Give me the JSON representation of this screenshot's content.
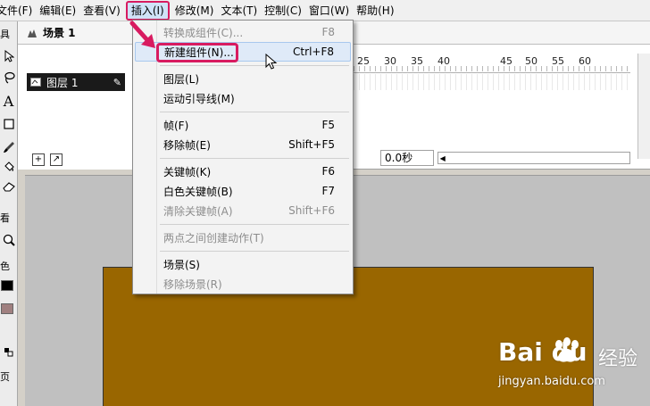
{
  "colors": {
    "highlight": "#d81b60",
    "canvas": "#996600",
    "stage": "#c0c0c0",
    "hover": "#dfeaf8"
  },
  "menubar": {
    "items": [
      {
        "label": "文件(F)"
      },
      {
        "label": "编辑(E)"
      },
      {
        "label": "查看(V)"
      },
      {
        "label": "插入(I)"
      },
      {
        "label": "修改(M)"
      },
      {
        "label": "文本(T)"
      },
      {
        "label": "控制(C)"
      },
      {
        "label": "窗口(W)"
      },
      {
        "label": "帮助(H)"
      }
    ]
  },
  "scene": {
    "label": "场景 1",
    "icon": "scene-icon"
  },
  "timeline": {
    "layer_name": "图层 1",
    "ruler": [
      "25",
      "30",
      "35",
      "40",
      "45",
      "50",
      "55",
      "60"
    ],
    "time": "0.0秒"
  },
  "insert_menu": {
    "items": [
      {
        "label": "转换成组件(C)...",
        "shortcut": "F8",
        "enabled": false
      },
      {
        "label": "新建组件(N)...",
        "shortcut": "Ctrl+F8",
        "enabled": true,
        "highlighted": true
      },
      {
        "label": "图层(L)",
        "shortcut": "",
        "enabled": true
      },
      {
        "label": "运动引导线(M)",
        "shortcut": "",
        "enabled": true
      },
      {
        "label": "帧(F)",
        "shortcut": "F5",
        "enabled": true
      },
      {
        "label": "移除帧(E)",
        "shortcut": "Shift+F5",
        "enabled": true
      },
      {
        "label": "关键帧(K)",
        "shortcut": "F6",
        "enabled": true
      },
      {
        "label": "白色关键帧(B)",
        "shortcut": "F7",
        "enabled": true
      },
      {
        "label": "清除关键帧(A)",
        "shortcut": "Shift+F6",
        "enabled": false
      },
      {
        "label": "两点之间创建动作(T)",
        "shortcut": "",
        "enabled": false
      },
      {
        "label": "场景(S)",
        "shortcut": "",
        "enabled": true
      },
      {
        "label": "移除场景(R)",
        "shortcut": "",
        "enabled": false
      }
    ]
  },
  "tools": {
    "text_tool": "A",
    "label_view": "看",
    "label_color": "色",
    "label_options": "页"
  },
  "watermark": {
    "logo": "Bai du",
    "cn": "经验",
    "url": "jingyan.baidu.com"
  }
}
